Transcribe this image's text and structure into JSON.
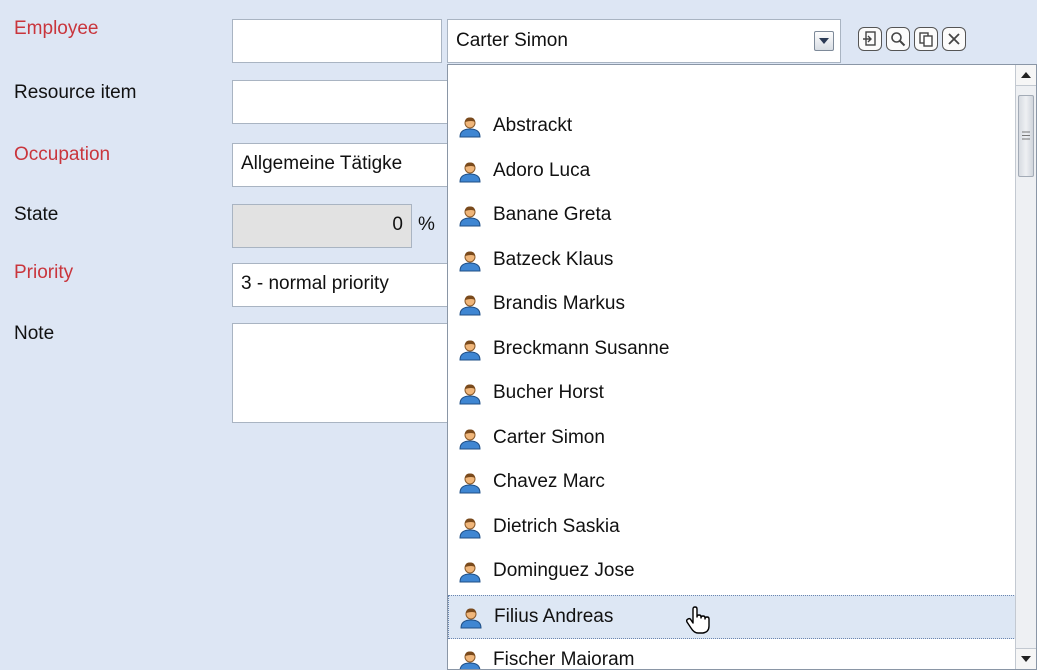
{
  "form": {
    "employee_label": "Employee",
    "resource_label": "Resource item",
    "occupation_label": "Occupation",
    "occupation_value": "Allgemeine Tätigke",
    "state_label": "State",
    "state_value": "0",
    "state_unit": "%",
    "priority_label": "Priority",
    "priority_value": "3 - normal priority",
    "note_label": "Note"
  },
  "combo": {
    "selected": "Carter Simon"
  },
  "icons": {
    "combo_toggle": "chevron-down-icon",
    "tools": [
      "import-icon",
      "search-icon",
      "copy-icon",
      "clear-icon"
    ],
    "list_item": "person-icon",
    "cursor": "hand-pointer-icon"
  },
  "dropdown": {
    "items": [
      "",
      "Abstrackt",
      "Adoro Luca",
      "Banane Greta",
      "Batzeck Klaus",
      "Brandis Markus",
      "Breckmann Susanne",
      "Bucher Horst",
      "Carter Simon",
      "Chavez Marc",
      "Dietrich Saskia",
      "Dominguez Jose",
      "Filius Andreas",
      "Fischer Maioram"
    ],
    "hover_item": "Filius Andreas"
  },
  "colors": {
    "background": "#dde6f4",
    "required_label": "#c9353c",
    "hover_row": "#dde7f4"
  }
}
